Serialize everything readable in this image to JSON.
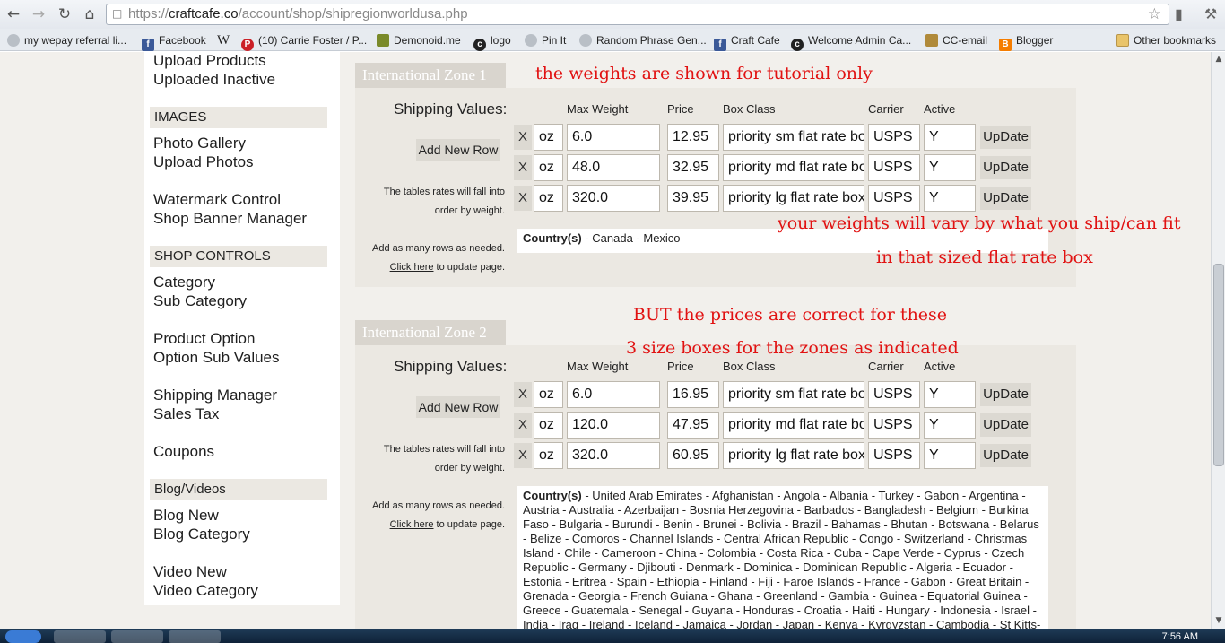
{
  "browser": {
    "url_prefix": "https://",
    "url_host": "craftcafe.co",
    "url_path": "/account/shop/shipregionworldusa.php",
    "bookmarks": [
      {
        "label": "my wepay referral li...",
        "icon": "globe-icon",
        "color": "#9aa0a6"
      },
      {
        "label": "Facebook",
        "icon": "facebook-icon",
        "color": "#3b5998"
      },
      {
        "label": "W",
        "icon": "wikipedia-icon",
        "color": "#ffffff"
      },
      {
        "label": "(10) Carrie Foster / P...",
        "icon": "pinterest-icon",
        "color": "#cb2027"
      },
      {
        "label": "Demonoid.me",
        "icon": "demonoid-icon",
        "color": "#7a8a2a"
      },
      {
        "label": "logo",
        "icon": "cc-icon",
        "color": "#222222"
      },
      {
        "label": "Pin It",
        "icon": "globe-icon",
        "color": "#9aa0a6"
      },
      {
        "label": "Random Phrase Gen...",
        "icon": "globe-icon",
        "color": "#9aa0a6"
      },
      {
        "label": "Craft Cafe",
        "icon": "facebook-icon",
        "color": "#3b5998"
      },
      {
        "label": "Welcome Admin Ca...",
        "icon": "cc-icon",
        "color": "#222222"
      },
      {
        "label": "CC-email",
        "icon": "cc-email-icon",
        "color": "#b08a3a"
      },
      {
        "label": "Blogger",
        "icon": "blogger-icon",
        "color": "#f57d00"
      }
    ],
    "other_bookmarks": "Other bookmarks"
  },
  "sidebar": {
    "upload_products": "Upload Products",
    "uploaded_inactive": "Uploaded Inactive",
    "images_head": "IMAGES",
    "photo_gallery": "Photo Gallery",
    "upload_photos": "Upload Photos",
    "watermark_control": "Watermark Control",
    "shop_banner_manager": "Shop Banner Manager",
    "shop_controls_head": "SHOP CONTROLS",
    "category": "Category",
    "sub_category": "Sub Category",
    "product_option": "Product Option",
    "option_sub_values": "Option Sub Values",
    "shipping_manager": "Shipping Manager",
    "sales_tax": "Sales Tax",
    "coupons": "Coupons",
    "blog_videos_head": "Blog/Videos",
    "blog_new": "Blog New",
    "blog_category": "Blog Category",
    "video_new": "Video New",
    "video_category": "Video Category"
  },
  "common": {
    "shipping_values": "Shipping Values:",
    "col_max_weight": "Max Weight",
    "col_price": "Price",
    "col_box_class": "Box Class",
    "col_carrier": "Carrier",
    "col_active": "Active",
    "add_new_row": "Add New Row",
    "note_line1": "The tables rates will fall into",
    "note_line2": "order by weight.",
    "note_line3": "Add as many rows as needed.",
    "click_here": "Click here",
    "update_page": " to update page.",
    "x_label": "X",
    "update_label": "UpDate",
    "countries_label": "Country(s)"
  },
  "zones": [
    {
      "title": "International Zone 1",
      "rows": [
        {
          "unit": "oz",
          "weight": "6.0",
          "price": "12.95",
          "box": "priority sm flat rate bo",
          "carrier": "USPS",
          "active": "Y"
        },
        {
          "unit": "oz",
          "weight": "48.0",
          "price": "32.95",
          "box": "priority md flat rate bo",
          "carrier": "USPS",
          "active": "Y"
        },
        {
          "unit": "oz",
          "weight": "320.0",
          "price": "39.95",
          "box": "priority lg flat rate box",
          "carrier": "USPS",
          "active": "Y"
        }
      ],
      "countries": " - Canada - Mexico"
    },
    {
      "title": "International Zone 2",
      "rows": [
        {
          "unit": "oz",
          "weight": "6.0",
          "price": "16.95",
          "box": "priority sm flat rate bo",
          "carrier": "USPS",
          "active": "Y"
        },
        {
          "unit": "oz",
          "weight": "120.0",
          "price": "47.95",
          "box": "priority md flat rate bo",
          "carrier": "USPS",
          "active": "Y"
        },
        {
          "unit": "oz",
          "weight": "320.0",
          "price": "60.95",
          "box": "priority lg flat rate box",
          "carrier": "USPS",
          "active": "Y"
        }
      ],
      "countries": " - United Arab Emirates - Afghanistan - Angola - Albania - Turkey - Gabon - Argentina - Austria - Australia - Azerbaijan - Bosnia Herzegovina - Barbados - Bangladesh - Belgium - Burkina Faso - Bulgaria - Burundi - Benin - Brunei - Bolivia - Brazil - Bahamas - Bhutan - Botswana - Belarus - Belize - Comoros - Channel Islands - Central African Republic - Congo - Switzerland - Christmas Island - Chile - Cameroon - China - Colombia - Costa Rica - Cuba - Cape Verde - Cyprus - Czech Republic - Germany - Djibouti - Denmark - Dominica - Dominican Republic - Algeria - Ecuador - Estonia - Eritrea - Spain - Ethiopia - Finland - Fiji - Faroe Islands - France - Gabon - Great Britain - Grenada - Georgia - French Guiana - Ghana - Greenland - Gambia - Guinea - Equatorial Guinea - Greece - Guatemala - Senegal - Guyana - Honduras - Croatia - Haiti - Hungary - Indonesia - Israel - India - Iraq - Ireland - Iceland - Jamaica - Jordan - Japan - Kenya - Kyrgyzstan - Cambodia - St Kitts-"
    }
  ],
  "annotations": {
    "a1": "the weights are shown for tutorial only",
    "a2": "your weights will vary by what you ship/can fit",
    "a3": "in that sized flat rate box",
    "a4": "BUT the prices are correct for these",
    "a5": "3 size boxes for the zones as indicated",
    "color": "#e11212"
  },
  "taskbar": {
    "clock": "7:56 AM"
  }
}
